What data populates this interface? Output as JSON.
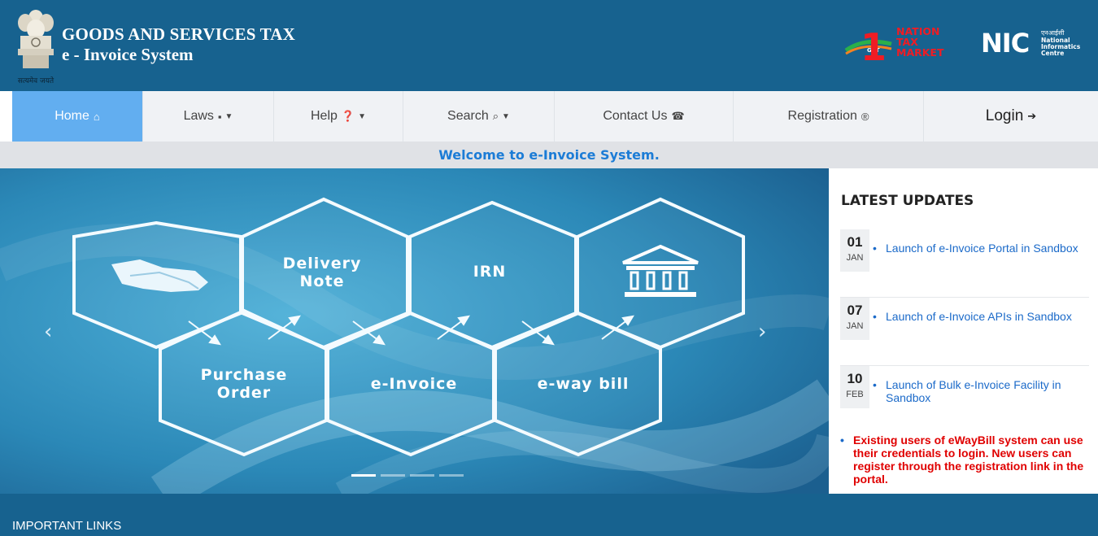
{
  "header": {
    "title": "GOODS AND SERVICES TAX",
    "subtitle": "e - Invoice System",
    "emblem_motto": "सत्यमेव जयते",
    "gst_logo_text": [
      "NATION",
      "TAX",
      "MARKET"
    ],
    "gst_logo_number": "1",
    "gst_logo_tag": "GST",
    "nic_logo_text": "NIC",
    "nic_logo_sub": [
      "एनआईसी",
      "National",
      "Informatics",
      "Centre"
    ]
  },
  "nav": {
    "home": "Home",
    "laws": "Laws",
    "help": "Help",
    "search": "Search",
    "contact": "Contact Us",
    "registration": "Registration",
    "login": "Login"
  },
  "welcome": "Welcome to e-Invoice System.",
  "slider": {
    "hexagons": {
      "delivery_note": [
        "Delivery",
        "Note"
      ],
      "irn": "IRN",
      "purchase_order": [
        "Purchase",
        "Order"
      ],
      "e_invoice": "e-Invoice",
      "e_way_bill": "e-way bill"
    },
    "slide_count": 4,
    "active_slide": 1
  },
  "updates": {
    "title": "LATEST UPDATES",
    "items": [
      {
        "day": "01",
        "month": "JAN",
        "text": "Launch of e-Invoice Portal in Sandbox"
      },
      {
        "day": "07",
        "month": "JAN",
        "text": "Launch of e-Invoice APIs in Sandbox"
      },
      {
        "day": "10",
        "month": "FEB",
        "text": "Launch of Bulk e-Invoice Facility in Sandbox"
      }
    ],
    "notice": "Existing users of eWayBill system can use their credentials to login. New users can register through the registration link in the portal."
  },
  "footer": {
    "title": "IMPORTANT LINKS"
  },
  "colors": {
    "header_bg": "#17628f",
    "nav_active": "#62aef0",
    "welcome_text": "#1c7cd6",
    "link": "#1b6ac9",
    "notice": "#e00000"
  },
  "icons": {
    "home": "home-icon",
    "laws": "briefcase-icon",
    "help": "question-circle-icon",
    "search": "search-plus-icon",
    "contact": "phone-icon",
    "registration": "registered-icon",
    "login": "sign-in-icon"
  }
}
